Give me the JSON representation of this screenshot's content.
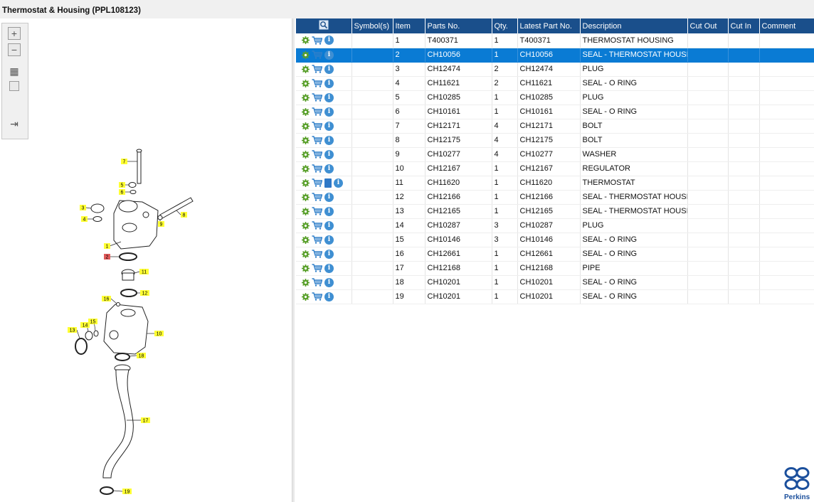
{
  "window": {
    "title": "Thermostat & Housing (PPL108123)"
  },
  "toolbar": {
    "items": [
      {
        "name": "zoom-in",
        "glyph": "+"
      },
      {
        "name": "zoom-out",
        "glyph": "−"
      },
      {
        "name": "fit-all",
        "glyph": "▦"
      },
      {
        "name": "actual-size",
        "glyph": "□"
      },
      {
        "name": "export",
        "glyph": "⇥"
      }
    ]
  },
  "diagram": {
    "callouts": [
      "1",
      "2",
      "3",
      "4",
      "5",
      "6",
      "7",
      "8",
      "9",
      "10",
      "11",
      "12",
      "13",
      "14",
      "15",
      "16",
      "17",
      "18",
      "19"
    ],
    "highlighted_callout": "2",
    "colors": {
      "callout_bg": "#ffff33",
      "selected_callout_bg": "#e05a5a",
      "line": "#222222"
    }
  },
  "grid": {
    "columns": [
      "Symbol(s)",
      "Item",
      "Parts No.",
      "Qty.",
      "Latest Part No.",
      "Description",
      "Cut Out",
      "Cut In",
      "Comment"
    ],
    "header_icon": "search-doc-icon",
    "selected_row_index": 1,
    "colors": {
      "header_bg": "#1a4f8b",
      "selected_bg": "#0a7bd4",
      "gear": "#5aa02c",
      "cart": "#2f7fc9",
      "info": "#3f8fd2"
    },
    "rows": [
      {
        "icons": [
          "gear-icon",
          "cart-icon",
          "info-icon"
        ],
        "symbols": "",
        "item": "1",
        "part_no": "T400371",
        "qty": "1",
        "latest": "T400371",
        "description": "THERMOSTAT HOUSING",
        "cut_out": "",
        "cut_in": "",
        "comment": ""
      },
      {
        "icons": [
          "gear-icon",
          "cart-icon",
          "info-icon"
        ],
        "symbols": "",
        "item": "2",
        "part_no": "CH10056",
        "qty": "1",
        "latest": "CH10056",
        "description": "SEAL - THERMOSTAT HOUSIN",
        "cut_out": "",
        "cut_in": "",
        "comment": ""
      },
      {
        "icons": [
          "gear-icon",
          "cart-icon",
          "info-icon"
        ],
        "symbols": "",
        "item": "3",
        "part_no": "CH12474",
        "qty": "2",
        "latest": "CH12474",
        "description": "PLUG",
        "cut_out": "",
        "cut_in": "",
        "comment": ""
      },
      {
        "icons": [
          "gear-icon",
          "cart-icon",
          "info-icon"
        ],
        "symbols": "",
        "item": "4",
        "part_no": "CH11621",
        "qty": "2",
        "latest": "CH11621",
        "description": "SEAL - O RING",
        "cut_out": "",
        "cut_in": "",
        "comment": ""
      },
      {
        "icons": [
          "gear-icon",
          "cart-icon",
          "info-icon"
        ],
        "symbols": "",
        "item": "5",
        "part_no": "CH10285",
        "qty": "1",
        "latest": "CH10285",
        "description": "PLUG",
        "cut_out": "",
        "cut_in": "",
        "comment": ""
      },
      {
        "icons": [
          "gear-icon",
          "cart-icon",
          "info-icon"
        ],
        "symbols": "",
        "item": "6",
        "part_no": "CH10161",
        "qty": "1",
        "latest": "CH10161",
        "description": "SEAL - O RING",
        "cut_out": "",
        "cut_in": "",
        "comment": ""
      },
      {
        "icons": [
          "gear-icon",
          "cart-icon",
          "info-icon"
        ],
        "symbols": "",
        "item": "7",
        "part_no": "CH12171",
        "qty": "4",
        "latest": "CH12171",
        "description": "BOLT",
        "cut_out": "",
        "cut_in": "",
        "comment": ""
      },
      {
        "icons": [
          "gear-icon",
          "cart-icon",
          "info-icon"
        ],
        "symbols": "",
        "item": "8",
        "part_no": "CH12175",
        "qty": "4",
        "latest": "CH12175",
        "description": "BOLT",
        "cut_out": "",
        "cut_in": "",
        "comment": ""
      },
      {
        "icons": [
          "gear-icon",
          "cart-icon",
          "info-icon"
        ],
        "symbols": "",
        "item": "9",
        "part_no": "CH10277",
        "qty": "4",
        "latest": "CH10277",
        "description": "WASHER",
        "cut_out": "",
        "cut_in": "",
        "comment": ""
      },
      {
        "icons": [
          "gear-icon",
          "cart-icon",
          "info-icon"
        ],
        "symbols": "",
        "item": "10",
        "part_no": "CH12167",
        "qty": "1",
        "latest": "CH12167",
        "description": "REGULATOR",
        "cut_out": "",
        "cut_in": "",
        "comment": ""
      },
      {
        "icons": [
          "gear-icon",
          "cart-icon",
          "doc-icon",
          "info-icon"
        ],
        "symbols": "",
        "item": "11",
        "part_no": "CH11620",
        "qty": "1",
        "latest": "CH11620",
        "description": "THERMOSTAT",
        "cut_out": "",
        "cut_in": "",
        "comment": ""
      },
      {
        "icons": [
          "gear-icon",
          "cart-icon",
          "info-icon"
        ],
        "symbols": "",
        "item": "12",
        "part_no": "CH12166",
        "qty": "1",
        "latest": "CH12166",
        "description": "SEAL - THERMOSTAT HOUSIN",
        "cut_out": "",
        "cut_in": "",
        "comment": ""
      },
      {
        "icons": [
          "gear-icon",
          "cart-icon",
          "info-icon"
        ],
        "symbols": "",
        "item": "13",
        "part_no": "CH12165",
        "qty": "1",
        "latest": "CH12165",
        "description": "SEAL - THERMOSTAT HOUSIN",
        "cut_out": "",
        "cut_in": "",
        "comment": ""
      },
      {
        "icons": [
          "gear-icon",
          "cart-icon",
          "info-icon"
        ],
        "symbols": "",
        "item": "14",
        "part_no": "CH10287",
        "qty": "3",
        "latest": "CH10287",
        "description": "PLUG",
        "cut_out": "",
        "cut_in": "",
        "comment": ""
      },
      {
        "icons": [
          "gear-icon",
          "cart-icon",
          "info-icon"
        ],
        "symbols": "",
        "item": "15",
        "part_no": "CH10146",
        "qty": "3",
        "latest": "CH10146",
        "description": "SEAL - O RING",
        "cut_out": "",
        "cut_in": "",
        "comment": ""
      },
      {
        "icons": [
          "gear-icon",
          "cart-icon",
          "info-icon"
        ],
        "symbols": "",
        "item": "16",
        "part_no": "CH12661",
        "qty": "1",
        "latest": "CH12661",
        "description": "SEAL - O RING",
        "cut_out": "",
        "cut_in": "",
        "comment": ""
      },
      {
        "icons": [
          "gear-icon",
          "cart-icon",
          "info-icon"
        ],
        "symbols": "",
        "item": "17",
        "part_no": "CH12168",
        "qty": "1",
        "latest": "CH12168",
        "description": "PIPE",
        "cut_out": "",
        "cut_in": "",
        "comment": ""
      },
      {
        "icons": [
          "gear-icon",
          "cart-icon",
          "info-icon"
        ],
        "symbols": "",
        "item": "18",
        "part_no": "CH10201",
        "qty": "1",
        "latest": "CH10201",
        "description": "SEAL - O RING",
        "cut_out": "",
        "cut_in": "",
        "comment": ""
      },
      {
        "icons": [
          "gear-icon",
          "cart-icon",
          "info-icon"
        ],
        "symbols": "",
        "item": "19",
        "part_no": "CH10201",
        "qty": "1",
        "latest": "CH10201",
        "description": "SEAL - O RING",
        "cut_out": "",
        "cut_in": "",
        "comment": ""
      }
    ]
  },
  "brand": {
    "name": "Perkins",
    "color": "#1b4f9c"
  }
}
